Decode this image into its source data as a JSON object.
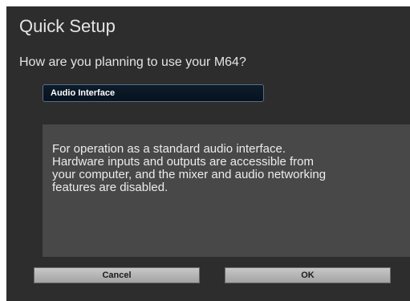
{
  "dialog": {
    "title": "Quick Setup",
    "question": "How are you planning to use your M64?",
    "mode_select": {
      "selected": "Audio Interface"
    },
    "description": "For operation as a standard audio interface.\nHardware inputs and outputs are accessible from\nyour computer, and the mixer and audio networking\nfeatures are disabled.",
    "buttons": {
      "cancel_label": "Cancel",
      "ok_label": "OK"
    }
  },
  "colors": {
    "background": "#2d2d2d",
    "panel": "#484848",
    "select_background": "#0d1c2b",
    "button": "#b5b5b5"
  }
}
